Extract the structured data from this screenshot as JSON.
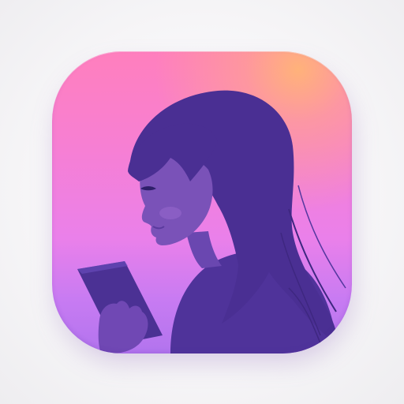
{
  "app_icon": {
    "shape": "rounded-square",
    "subject": "girl-silhouette-reading-phone-icon",
    "colors": {
      "background_top": "#ff7fbd",
      "background_bottom": "#b274ee",
      "glow": "#ffb27a",
      "silhouette": "#5a3a9e",
      "silhouette_dark": "#45308a",
      "skin": "#7a52b8",
      "phone": "#4b3194"
    }
  }
}
